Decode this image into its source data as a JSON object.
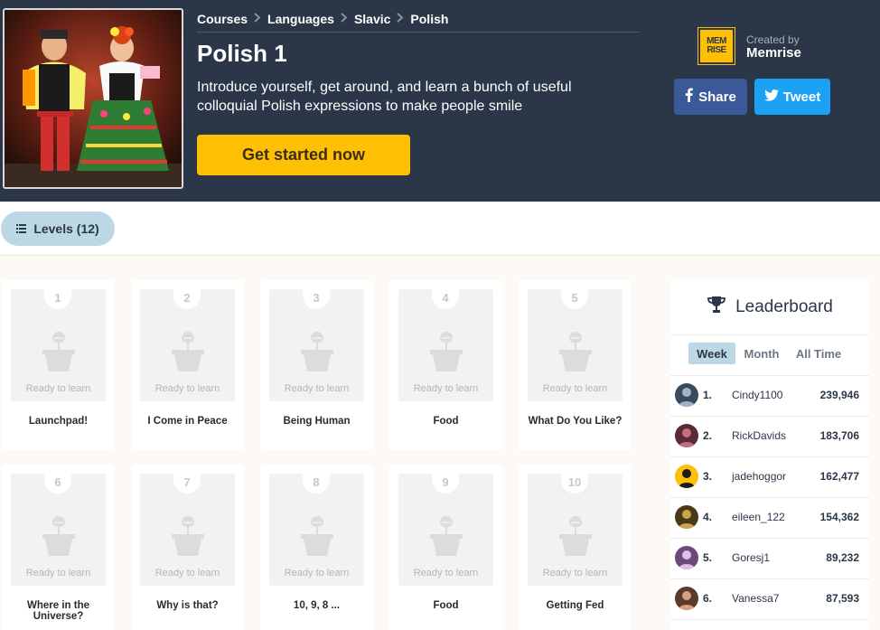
{
  "breadcrumb": [
    "Courses",
    "Languages",
    "Slavic",
    "Polish"
  ],
  "course": {
    "title": "Polish 1",
    "description": "Introduce yourself, get around, and learn a bunch of useful colloquial Polish expressions to make people smile",
    "cta": "Get started now"
  },
  "creator": {
    "created_by_label": "Created by",
    "name": "Memrise",
    "logo_line1": "MEM",
    "logo_line2": "RISE"
  },
  "social": {
    "share": "Share",
    "tweet": "Tweet"
  },
  "tabs": {
    "levels": "Levels (12)"
  },
  "levels": [
    {
      "number": "1",
      "title": "Launchpad!",
      "status": "Ready to learn"
    },
    {
      "number": "2",
      "title": "I Come in Peace",
      "status": "Ready to learn"
    },
    {
      "number": "3",
      "title": "Being Human",
      "status": "Ready to learn"
    },
    {
      "number": "4",
      "title": "Food",
      "status": "Ready to learn"
    },
    {
      "number": "5",
      "title": "What Do You Like?",
      "status": "Ready to learn"
    },
    {
      "number": "6",
      "title": "Where in the Universe?",
      "status": "Ready to learn"
    },
    {
      "number": "7",
      "title": "Why is that?",
      "status": "Ready to learn"
    },
    {
      "number": "8",
      "title": "10, 9, 8 ...",
      "status": "Ready to learn"
    },
    {
      "number": "9",
      "title": "Food",
      "status": "Ready to learn"
    },
    {
      "number": "10",
      "title": "Getting Fed",
      "status": "Ready to learn"
    }
  ],
  "leaderboard": {
    "title": "Leaderboard",
    "tabs": [
      "Week",
      "Month",
      "All Time"
    ],
    "active_tab": "Week",
    "rows": [
      {
        "rank": "1.",
        "name": "Cindy1100",
        "score": "239,946"
      },
      {
        "rank": "2.",
        "name": "RickDavids",
        "score": "183,706"
      },
      {
        "rank": "3.",
        "name": "jadehoggor",
        "score": "162,477"
      },
      {
        "rank": "4.",
        "name": "eileen_122",
        "score": "154,362"
      },
      {
        "rank": "5.",
        "name": "Goresj1",
        "score": "89,232"
      },
      {
        "rank": "6.",
        "name": "Vanessa7",
        "score": "87,593"
      }
    ]
  },
  "colors": {
    "header_bg": "#2b3648",
    "accent_yellow": "#ffc003",
    "facebook": "#3b5998",
    "twitter": "#1da1f2",
    "tab_active": "#bcd8e4",
    "page_bg": "#fdf9f4"
  },
  "icons": {
    "breadcrumb_separator": "chevron-right-icon",
    "levels_tab": "list-icon",
    "leaderboard": "trophy-icon",
    "share": "facebook-icon",
    "tweet": "twitter-icon",
    "level_placeholder": "flower-pot-icon"
  }
}
